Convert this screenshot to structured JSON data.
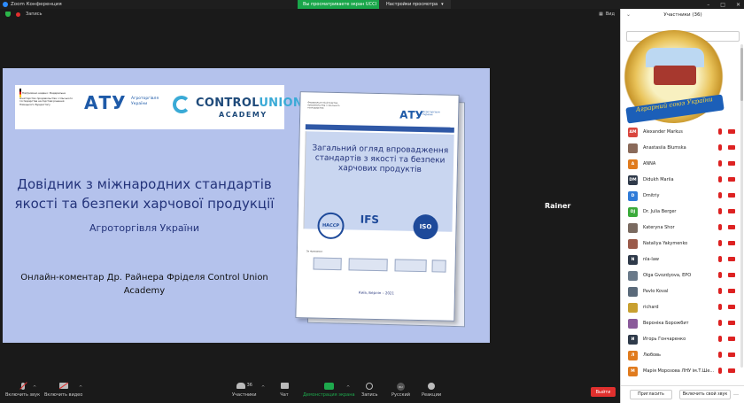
{
  "window": {
    "title": "Zoom Конференция"
  },
  "share_banner": {
    "text": "Вы просматриваете экран UCCI"
  },
  "view_options": {
    "label": "Настройки просмотра"
  },
  "top_bar": {
    "record_label": "Запись",
    "view_label": "Вид"
  },
  "slide": {
    "ministry_text": "Підтримано надано: Федеральне міністерство продовольства і сільського господарства на підставі рішення Німецького Бундестагу",
    "atu": "АТУ",
    "atu_sub": "Агроторгівля України",
    "cu_name_a": "CONTROL",
    "cu_name_b": "UNION",
    "cu_academy": "ACADEMY",
    "title": "Довідник з міжнародних стандартів якості та безпеки харчової продукції",
    "subtitle": "Агроторгівля України",
    "commentary": "Онлайн-коментар Др. Райнера Фріделя Control Union Academy",
    "book": {
      "ministry": "Федеральне міністерство продовольства і сільського господарства",
      "atu": "АТУ",
      "atu_sub": "Агроторгівля України",
      "title": "Загальний огляд впровадження стандартів з якості та безпеки харчових продуктів",
      "haccp": "HACCP",
      "ifs": "IFS",
      "iso": "ISO",
      "partners_label": "За підтримки:",
      "city": "Київ, Берлін – 2021"
    }
  },
  "rainer_tile": {
    "name": "Rainer"
  },
  "toolbar": {
    "mic_label": "Включить звук",
    "video_label": "Включить видео",
    "participants_label": "Участники",
    "participants_count": "36",
    "chat_label": "Чат",
    "share_label": "Демонстрация экрана",
    "record_label": "Запись",
    "lang_label": "Русский",
    "lang_badge": "RU",
    "reactions_label": "Реакции",
    "leave_label": "Выйти"
  },
  "panel": {
    "title": "Участники (36)",
    "banner_text": "Аграрний союз України",
    "participants": [
      {
        "initials": "AM",
        "name": "Alexander Markus",
        "color": "#d9463e"
      },
      {
        "initials": "",
        "name": "Anastasiia Blumska",
        "color": "#8a6a5a"
      },
      {
        "initials": "A",
        "name": "ANNA",
        "color": "#e07b1e"
      },
      {
        "initials": "DM",
        "name": "Didukh Mariia",
        "color": "#2f3a4a"
      },
      {
        "initials": "D",
        "name": "Dmitriy",
        "color": "#2f7bd8"
      },
      {
        "initials": "DJ",
        "name": "Dr. Julia Berger",
        "color": "#3aaa3a"
      },
      {
        "initials": "",
        "name": "Kateryna Shor",
        "color": "#7a6a60"
      },
      {
        "initials": "",
        "name": "Nataliya Yakymenko",
        "color": "#9a5a4a"
      },
      {
        "initials": "N",
        "name": "nla-law",
        "color": "#2f3a4a"
      },
      {
        "initials": "",
        "name": "Olga Gvozdyova, EPO",
        "color": "#6a7a8a"
      },
      {
        "initials": "",
        "name": "Pavlo Koval",
        "color": "#5a6a7a"
      },
      {
        "initials": "",
        "name": "richard",
        "color": "#c8a030"
      },
      {
        "initials": "",
        "name": "Вероніка Борожбит",
        "color": "#8a5a9a"
      },
      {
        "initials": "И",
        "name": "Игорь Гончаренко",
        "color": "#2f3a4a"
      },
      {
        "initials": "Л",
        "name": "Любовь",
        "color": "#e07b1e"
      },
      {
        "initials": "М",
        "name": "Марія Морозова ЛНУ ім.Т.Ше...",
        "color": "#e07b1e"
      }
    ],
    "invite_label": "Пригласить",
    "unmute_label": "Включить свой звук"
  }
}
